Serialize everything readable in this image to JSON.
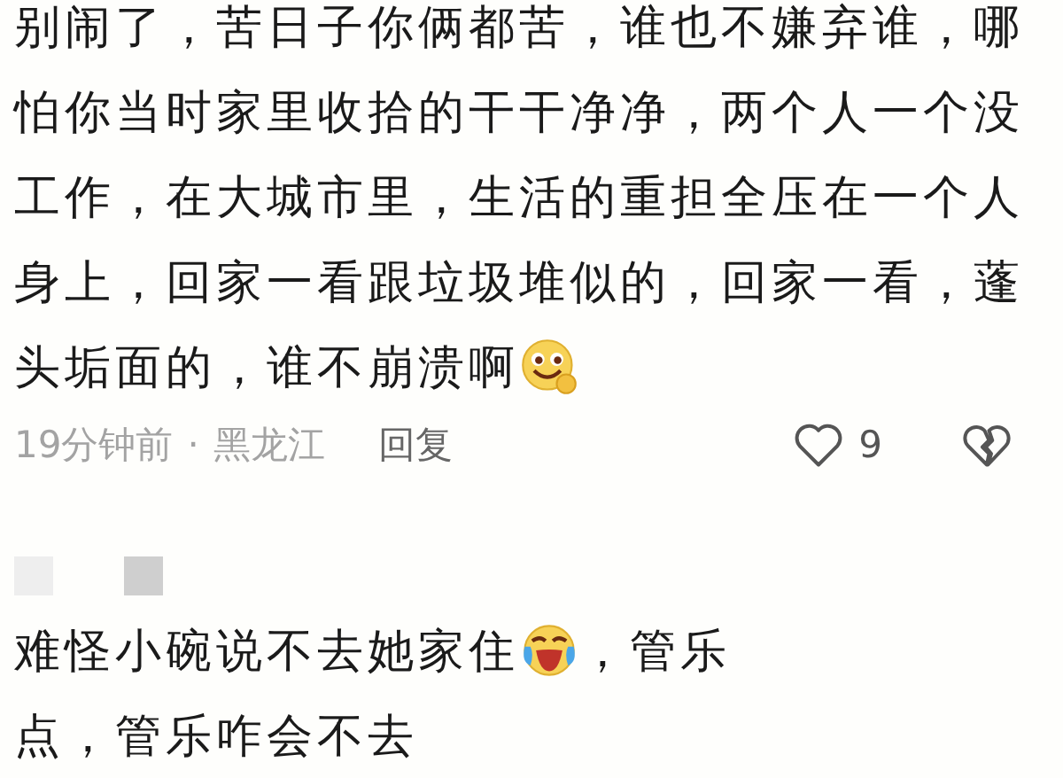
{
  "comments": [
    {
      "lines": [
        [
          {
            "kind": "text",
            "text": "别闹了，苦日子你俩都苦，谁也不嫌弃谁，哪"
          }
        ],
        [
          {
            "kind": "text",
            "text": "怕你当时家里收拾的干干净净，两个人一个没"
          }
        ],
        [
          {
            "kind": "text",
            "text": "工作，在大城市里，生活的重担全压在一个人"
          }
        ],
        [
          {
            "kind": "text",
            "text": "身上，回家一看跟垃圾堆似的，回家一看，蓬"
          }
        ],
        [
          {
            "kind": "text",
            "text": "头垢面的，谁不崩溃啊"
          },
          {
            "kind": "emoji-smile"
          }
        ]
      ],
      "meta": {
        "time": "19分钟前",
        "separator": "·",
        "location": "黑龙江",
        "reply": "回复",
        "likes": "9"
      }
    },
    {
      "author_hidden": true,
      "lines": [
        [
          {
            "kind": "text",
            "text": "难怪小碗说不去她家住"
          },
          {
            "kind": "emoji-laugh"
          },
          {
            "kind": "text",
            "text": "，管乐"
          }
        ],
        [
          {
            "kind": "text",
            "text": "点，管乐咋会不去"
          }
        ]
      ]
    }
  ]
}
